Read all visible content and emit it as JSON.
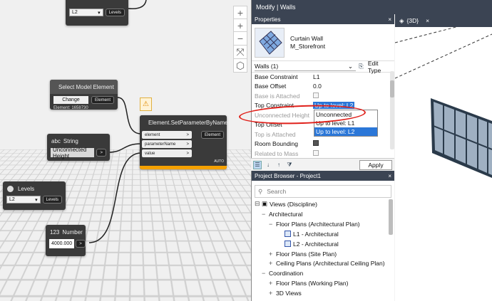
{
  "dynamo": {
    "top_node": {
      "dropdown": "L2",
      "output": "Levels"
    },
    "select_model_element": {
      "title": "Select Model Element",
      "button": "Change",
      "output": "Element",
      "info": "Element: 1658730"
    },
    "string_node": {
      "title": "String",
      "prefix": "abc",
      "value": "Unconnected Height",
      "port": ">"
    },
    "set_param": {
      "title": "Element.SetParameterByName",
      "inputs": [
        "element",
        "parameterName",
        "value"
      ],
      "output": "Element",
      "lacing": "AUTO",
      "warning_icon": "warning-icon"
    },
    "levels_node": {
      "title": "Levels",
      "dropdown": "L2",
      "output": "Levels"
    },
    "number_node": {
      "title": "Number",
      "prefix": "123",
      "value": "4000.000",
      "port": ">"
    },
    "nav_buttons": [
      "+",
      "−",
      "⤧",
      "⬡"
    ]
  },
  "revit": {
    "ribbon_title": "Modify | Walls",
    "properties": {
      "header": "Properties",
      "close": "×",
      "type_family": "Curtain Wall",
      "type_name": "M_Storefront",
      "selector": "Walls (1)",
      "edit_type": "Edit Type",
      "rows": [
        {
          "key": "Base Constraint",
          "value": "L1",
          "disabled": false
        },
        {
          "key": "Base Offset",
          "value": "0.0",
          "disabled": false
        },
        {
          "key": "Base is Attached",
          "value": "",
          "disabled": true
        },
        {
          "key": "Top Constraint",
          "value": "Up to level: L2",
          "disabled": false
        },
        {
          "key": "Unconnected Height",
          "value": "",
          "disabled": true
        },
        {
          "key": "Top Offset",
          "value": "",
          "disabled": false
        },
        {
          "key": "Top is Attached",
          "value": "",
          "disabled": true
        },
        {
          "key": "Room Bounding",
          "value": "",
          "disabled": false
        },
        {
          "key": "Related to Mass",
          "value": "",
          "disabled": true
        }
      ],
      "dropdown_options": [
        "Unconnected",
        "Up to level: L1",
        "Up to level: L2"
      ],
      "dropdown_selected": "Up to level: L2",
      "apply": "Apply"
    },
    "browser": {
      "header": "Project Browser - Project1",
      "close": "×",
      "search_placeholder": "Search",
      "tree": [
        {
          "toggle": "⊟",
          "label": "Views (Discipline)"
        },
        {
          "toggle": "−",
          "label": "Architectural"
        },
        {
          "toggle": "−",
          "label": "Floor Plans (Architectural Plan)"
        },
        {
          "toggle": "",
          "label": "L1 - Architectural"
        },
        {
          "toggle": "",
          "label": "L2 - Architectural"
        },
        {
          "toggle": "+",
          "label": "Floor Plans (Site Plan)"
        },
        {
          "toggle": "+",
          "label": "Ceiling Plans (Architectural Ceiling Plan)"
        },
        {
          "toggle": "−",
          "label": "Coordination"
        },
        {
          "toggle": "+",
          "label": "Floor Plans (Working Plan)"
        },
        {
          "toggle": "+",
          "label": "3D Views"
        }
      ]
    },
    "view_tab": {
      "label": "{3D}",
      "close": "×"
    }
  }
}
